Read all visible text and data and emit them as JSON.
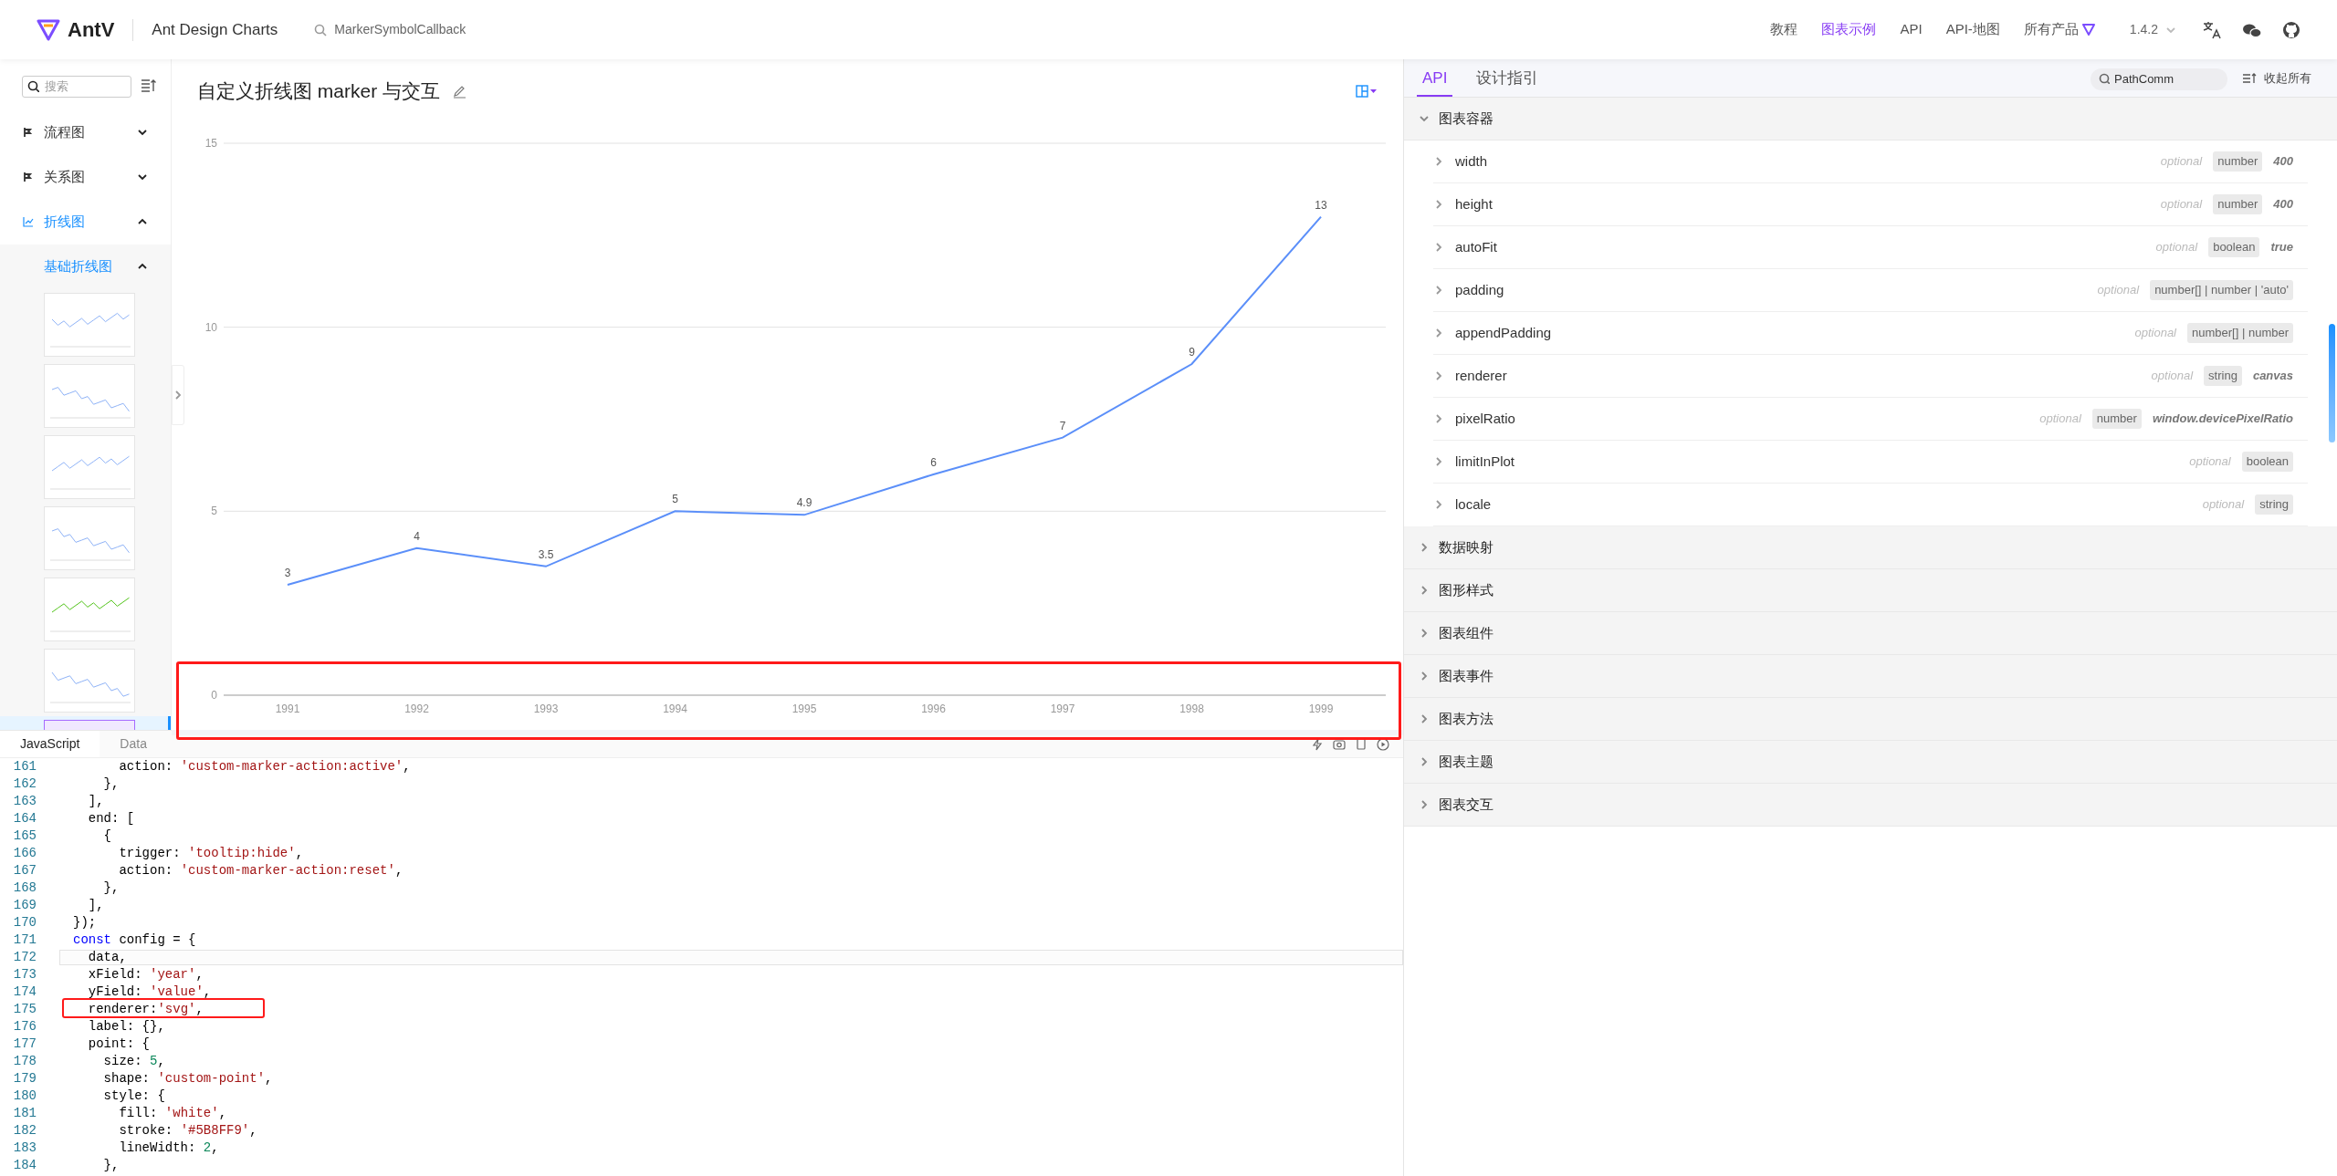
{
  "header": {
    "logo": "AntV",
    "product": "Ant Design Charts",
    "search": "MarkerSymbolCallback",
    "nav": [
      {
        "label": "教程",
        "selected": false,
        "kind": "link"
      },
      {
        "label": "图表示例",
        "selected": true,
        "kind": "link"
      },
      {
        "label": "API",
        "selected": false,
        "kind": "link"
      },
      {
        "label": "API-地图",
        "selected": false,
        "kind": "link"
      },
      {
        "label": "所有产品",
        "selected": false,
        "kind": "products"
      }
    ],
    "version": "1.4.2"
  },
  "sidebar": {
    "search": {
      "placeholder": "搜索"
    },
    "items": [
      {
        "label": "流程图",
        "expanded": false,
        "selected": false
      },
      {
        "label": "关系图",
        "expanded": false,
        "selected": false
      },
      {
        "label": "折线图",
        "expanded": true,
        "selected": true,
        "children": [
          {
            "label": "基础折线图",
            "expanded": true,
            "selected": true,
            "thumbnails": [
              {
                "kind": "picture",
                "selected": false
              },
              {
                "kind": "picture",
                "selected": false
              },
              {
                "kind": "picture",
                "selected": false
              },
              {
                "kind": "picture",
                "selected": false
              },
              {
                "kind": "picture",
                "selected": false
              },
              {
                "kind": "picture",
                "selected": false
              },
              {
                "kind": "picture",
                "selected": true
              }
            ]
          }
        ]
      }
    ]
  },
  "chart": {
    "title": "自定义折线图 marker 与交互",
    "chart_data": {
      "type": "line",
      "categories": [
        "1991",
        "1992",
        "1993",
        "1994",
        "1995",
        "1996",
        "1997",
        "1998",
        "1999"
      ],
      "values": [
        3,
        4,
        3.5,
        5,
        4.9,
        6,
        7,
        9,
        13
      ],
      "ylim": [
        0,
        15
      ],
      "yticks": [
        0,
        5,
        10,
        15
      ],
      "data_labels": true
    }
  },
  "editor": {
    "tabs": [
      {
        "label": "JavaScript",
        "selected": true
      },
      {
        "label": "Data",
        "selected": false
      }
    ],
    "lines": [
      {
        "n": "161",
        "current": false,
        "tokens": [
          {
            "text": "      action: ",
            "kind": "plain"
          },
          {
            "text": "'custom-marker-action:active'",
            "kind": "string"
          },
          {
            "text": ",",
            "kind": "plain"
          }
        ]
      },
      {
        "n": "162",
        "current": false,
        "tokens": [
          {
            "text": "    },",
            "kind": "plain"
          }
        ]
      },
      {
        "n": "163",
        "current": false,
        "tokens": [
          {
            "text": "  ],",
            "kind": "plain"
          }
        ]
      },
      {
        "n": "164",
        "current": false,
        "tokens": [
          {
            "text": "  end: [",
            "kind": "plain"
          }
        ]
      },
      {
        "n": "165",
        "current": false,
        "tokens": [
          {
            "text": "    {",
            "kind": "plain"
          }
        ]
      },
      {
        "n": "166",
        "current": false,
        "tokens": [
          {
            "text": "      trigger: ",
            "kind": "plain"
          },
          {
            "text": "'tooltip:hide'",
            "kind": "string"
          },
          {
            "text": ",",
            "kind": "plain"
          }
        ]
      },
      {
        "n": "167",
        "current": false,
        "tokens": [
          {
            "text": "      action: ",
            "kind": "plain"
          },
          {
            "text": "'custom-marker-action:reset'",
            "kind": "string"
          },
          {
            "text": ",",
            "kind": "plain"
          }
        ]
      },
      {
        "n": "168",
        "current": false,
        "tokens": [
          {
            "text": "    },",
            "kind": "plain"
          }
        ]
      },
      {
        "n": "169",
        "current": false,
        "tokens": [
          {
            "text": "  ],",
            "kind": "plain"
          }
        ]
      },
      {
        "n": "170",
        "current": false,
        "tokens": [
          {
            "text": "});",
            "kind": "plain"
          }
        ]
      },
      {
        "n": "171",
        "current": false,
        "tokens": [
          {
            "text": "const",
            "kind": "keyword"
          },
          {
            "text": " config = {",
            "kind": "plain"
          }
        ]
      },
      {
        "n": "172",
        "current": true,
        "tokens": [
          {
            "text": "  data,",
            "kind": "plain"
          }
        ]
      },
      {
        "n": "173",
        "current": false,
        "tokens": [
          {
            "text": "  xField: ",
            "kind": "plain"
          },
          {
            "text": "'year'",
            "kind": "string"
          },
          {
            "text": ",",
            "kind": "plain"
          }
        ]
      },
      {
        "n": "174",
        "current": false,
        "tokens": [
          {
            "text": "  yField: ",
            "kind": "plain"
          },
          {
            "text": "'value'",
            "kind": "string"
          },
          {
            "text": ",",
            "kind": "plain"
          }
        ]
      },
      {
        "n": "175",
        "current": false,
        "tokens": [
          {
            "text": "  renderer:",
            "kind": "plain"
          },
          {
            "text": "'svg'",
            "kind": "string"
          },
          {
            "text": ",",
            "kind": "plain"
          }
        ]
      },
      {
        "n": "176",
        "current": false,
        "tokens": [
          {
            "text": "  label: {},",
            "kind": "plain"
          }
        ]
      },
      {
        "n": "177",
        "current": false,
        "tokens": [
          {
            "text": "  point: {",
            "kind": "plain"
          }
        ]
      },
      {
        "n": "178",
        "current": false,
        "tokens": [
          {
            "text": "    size: ",
            "kind": "plain"
          },
          {
            "text": "5",
            "kind": "number"
          },
          {
            "text": ",",
            "kind": "plain"
          }
        ]
      },
      {
        "n": "179",
        "current": false,
        "tokens": [
          {
            "text": "    shape: ",
            "kind": "plain"
          },
          {
            "text": "'custom-point'",
            "kind": "string"
          },
          {
            "text": ",",
            "kind": "plain"
          }
        ]
      },
      {
        "n": "180",
        "current": false,
        "tokens": [
          {
            "text": "    style: {",
            "kind": "plain"
          }
        ]
      },
      {
        "n": "181",
        "current": false,
        "tokens": [
          {
            "text": "      fill: ",
            "kind": "plain"
          },
          {
            "text": "'white'",
            "kind": "string"
          },
          {
            "text": ",",
            "kind": "plain"
          }
        ]
      },
      {
        "n": "182",
        "current": false,
        "tokens": [
          {
            "text": "      stroke: ",
            "kind": "plain"
          },
          {
            "text": "'#5B8FF9'",
            "kind": "string"
          },
          {
            "text": ",",
            "kind": "plain"
          }
        ]
      },
      {
        "n": "183",
        "current": false,
        "tokens": [
          {
            "text": "      lineWidth: ",
            "kind": "plain"
          },
          {
            "text": "2",
            "kind": "number"
          },
          {
            "text": ",",
            "kind": "plain"
          }
        ]
      },
      {
        "n": "184",
        "current": false,
        "tokens": [
          {
            "text": "    },",
            "kind": "plain"
          }
        ]
      }
    ]
  },
  "api_panel": {
    "tabs": [
      {
        "label": "API",
        "selected": true
      },
      {
        "label": "设计指引",
        "selected": false
      }
    ],
    "search": {
      "value": "PathComm"
    },
    "collapse_all": "收起所有",
    "sections": [
      {
        "title": "图表容器",
        "expanded": true,
        "props": [
          {
            "name": "width",
            "optional": "optional",
            "type": "number",
            "default": "400"
          },
          {
            "name": "height",
            "optional": "optional",
            "type": "number",
            "default": "400"
          },
          {
            "name": "autoFit",
            "optional": "optional",
            "type": "boolean",
            "default": "true"
          },
          {
            "name": "padding",
            "optional": "optional",
            "type": "number[] | number | 'auto'"
          },
          {
            "name": "appendPadding",
            "optional": "optional",
            "type": "number[] | number"
          },
          {
            "name": "renderer",
            "optional": "optional",
            "type": "string",
            "default": "canvas"
          },
          {
            "name": "pixelRatio",
            "optional": "optional",
            "type": "number",
            "default": "window.devicePixelRatio"
          },
          {
            "name": "limitInPlot",
            "optional": "optional",
            "type": "boolean"
          },
          {
            "name": "locale",
            "optional": "optional",
            "type": "string"
          }
        ]
      },
      {
        "title": "数据映射",
        "expanded": false
      },
      {
        "title": "图形样式",
        "expanded": false
      },
      {
        "title": "图表组件",
        "expanded": false
      },
      {
        "title": "图表事件",
        "expanded": false
      },
      {
        "title": "图表方法",
        "expanded": false
      },
      {
        "title": "图表主题",
        "expanded": false
      },
      {
        "title": "图表交互",
        "expanded": false
      }
    ]
  }
}
